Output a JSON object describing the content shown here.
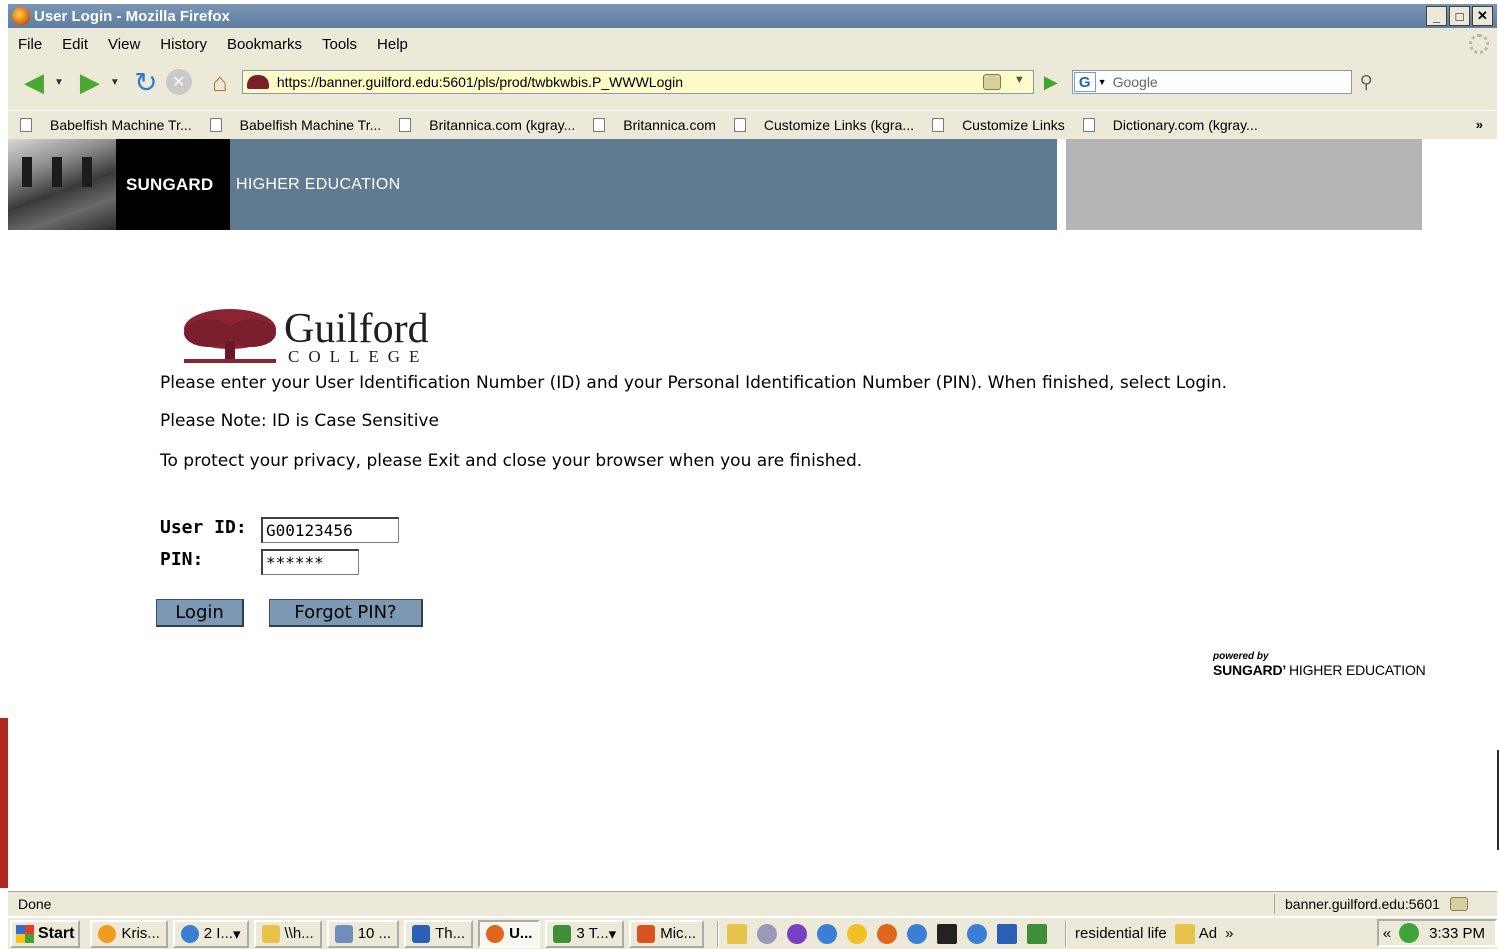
{
  "window": {
    "title": "User Login - Mozilla Firefox",
    "controls": [
      "_",
      "ř",
      "×"
    ]
  },
  "menu": [
    "File",
    "Edit",
    "View",
    "History",
    "Bookmarks",
    "Tools",
    "Help"
  ],
  "nav": {
    "url": "https://banner.guilford.edu:5601/pls/prod/twbkwbis.P_WWWLogin",
    "search_engine": "G",
    "search_placeholder": "Google"
  },
  "bookmarks": {
    "items": [
      "Babelfish Machine Tr...",
      "Babelfish Machine Tr...",
      "Britannica.com (kgray...",
      "Britannica.com",
      "Customize Links (kgra...",
      "Customize Links",
      "Dictionary.com (kgray..."
    ],
    "more": "»"
  },
  "banner": {
    "brand": "SUNGARD",
    "brand_sub": "HIGHER EDUCATION"
  },
  "logo": {
    "name": "Guilford",
    "sub": "COLLEGE"
  },
  "page": {
    "instructions": "Please enter your User Identification Number (ID) and your Personal Identification Number (PIN). When finished, select Login.",
    "note": "Please Note: ID is Case Sensitive",
    "privacy": "To protect your privacy, please Exit and close your browser when you are finished.",
    "user_id_label": "User ID:",
    "user_id_value": "G00123456",
    "pin_label": "PIN:",
    "pin_value": "******",
    "login_label": "Login",
    "forgot_label": "Forgot PIN?",
    "powered_by": "powered by",
    "powered_brand": "SUNGARD",
    "powered_sub": "HIGHER EDUCATION"
  },
  "status": {
    "text": "Done",
    "host": "banner.guilford.edu:5601"
  },
  "taskbar": {
    "start": "Start",
    "tasks": [
      {
        "label": "Kris...",
        "color": "#f29b1d"
      },
      {
        "label": "2 I...",
        "color": "#3a7fd5"
      },
      {
        "label": "\\\\h...",
        "color": "#e8c24a"
      },
      {
        "label": "10 ...",
        "color": "#6f8fb8"
      },
      {
        "label": "Th...",
        "color": "#2b5fb8"
      },
      {
        "label": "U...",
        "color": "#e0661b"
      },
      {
        "label": "3 T...",
        "color": "#3f8f3a"
      },
      {
        "label": "Mic...",
        "color": "#d9531e"
      }
    ],
    "tray_text_1": "residential life",
    "tray_text_2": "Ad",
    "expand": "»",
    "collapse": "«",
    "clock": "3:33 PM"
  }
}
